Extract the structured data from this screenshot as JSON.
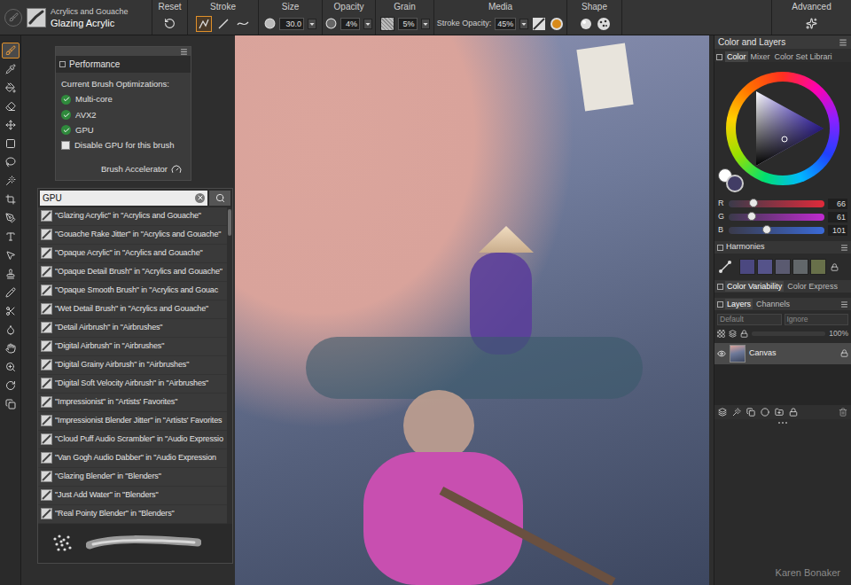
{
  "property_bar": {
    "category": "Acrylics and Gouache",
    "variant": "Glazing Acrylic",
    "reset": {
      "label": "Reset"
    },
    "stroke": {
      "label": "Stroke",
      "types": [
        {
          "selected": true
        },
        {
          "selected": false
        },
        {
          "selected": false
        }
      ]
    },
    "size": {
      "label": "Size",
      "value": "30.0"
    },
    "opacity": {
      "label": "Opacity",
      "value": "4%"
    },
    "grain": {
      "label": "Grain",
      "value": "5%"
    },
    "media": {
      "label": "Media",
      "stroke_opacity_label": "Stroke Opacity:",
      "stroke_opacity_value": "45%"
    },
    "shape": {
      "label": "Shape"
    },
    "advanced": {
      "label": "Advanced"
    }
  },
  "toolbox": {
    "tools": [
      {
        "selected": true
      },
      {
        "selected": false
      },
      {
        "selected": false
      },
      {
        "selected": false
      },
      {
        "selected": false
      },
      {
        "selected": false
      },
      {
        "selected": false
      },
      {
        "selected": false
      },
      {
        "selected": false
      },
      {
        "selected": false
      },
      {
        "selected": false
      },
      {
        "selected": false
      },
      {
        "selected": false
      },
      {
        "selected": false
      },
      {
        "selected": false
      },
      {
        "selected": false
      },
      {
        "selected": false
      },
      {
        "selected": false
      },
      {
        "selected": false
      },
      {
        "selected": false
      }
    ]
  },
  "performance": {
    "tab": "Performance",
    "heading": "Current Brush Optimizations:",
    "options": [
      {
        "label": "Multi-core",
        "checked": true,
        "kind": "status"
      },
      {
        "label": "AVX2",
        "checked": true,
        "kind": "status"
      },
      {
        "label": "GPU",
        "checked": true,
        "kind": "status"
      },
      {
        "label": "Disable GPU for this brush",
        "checked": false,
        "kind": "checkbox"
      }
    ],
    "accelerator": "Brush Accelerator"
  },
  "brush_search": {
    "query": "GPU",
    "results": [
      "\"Glazing Acrylic\" in \"Acrylics and Gouache\"",
      "\"Gouache Rake Jitter\" in \"Acrylics and Gouache\"",
      "\"Opaque Acrylic\" in \"Acrylics and Gouache\"",
      "\"Opaque Detail Brush\" in \"Acrylics and Gouache\"",
      "\"Opaque Smooth Brush\" in \"Acrylics and Gouac",
      "\"Wet Detail Brush\" in \"Acrylics and Gouache\"",
      "\"Detail Airbrush\" in \"Airbrushes\"",
      "\"Digital Airbrush\" in \"Airbrushes\"",
      "\"Digital Grainy Airbrush\" in \"Airbrushes\"",
      "\"Digital Soft Velocity Airbrush\" in \"Airbrushes\"",
      "\"Impressionist\" in \"Artists' Favorites\"",
      "\"Impressionist Blender Jitter\" in \"Artists' Favorites",
      "\"Cloud Puff Audio Scrambler\" in \"Audio Expressio",
      "\"Van Gogh Audio Dabber\" in \"Audio Expression",
      "\"Glazing Blender\" in \"Blenders\"",
      "\"Just Add Water\" in \"Blenders\"",
      "\"Real Pointy Blender\" in \"Blenders\""
    ]
  },
  "color_panel": {
    "title": "Color and Layers",
    "tabs": [
      {
        "label": "Color",
        "selected": true
      },
      {
        "label": "Mixer",
        "selected": false
      },
      {
        "label": "Color Set Librari",
        "selected": false
      }
    ],
    "main_color": "#423d65",
    "channels": [
      {
        "name": "R",
        "value": "66",
        "level": 0.26,
        "color": "#e02a3a"
      },
      {
        "name": "G",
        "value": "61",
        "level": 0.24,
        "color": "#c02ad0"
      },
      {
        "name": "B",
        "value": "101",
        "level": 0.4,
        "color": "#3a6ad8"
      }
    ]
  },
  "harmonies": {
    "title": "Harmonies",
    "swatches": [
      "#4b4880",
      "#55538a",
      "#5a5a70",
      "#62676a",
      "#68704a"
    ]
  },
  "variability_tabs": [
    {
      "label": "Color Variability",
      "selected": true
    },
    {
      "label": "Color Express",
      "selected": false
    }
  ],
  "layers_panel": {
    "tabs": [
      {
        "label": "Layers",
        "selected": true
      },
      {
        "label": "Channels",
        "selected": false
      }
    ],
    "composite_method": "Default",
    "composite_depth": "Ignore",
    "opacity": "100%",
    "layers": [
      {
        "name": "Canvas",
        "visible": true,
        "selected": true,
        "locked": true
      }
    ]
  },
  "watermark": "Karen Bonaker"
}
